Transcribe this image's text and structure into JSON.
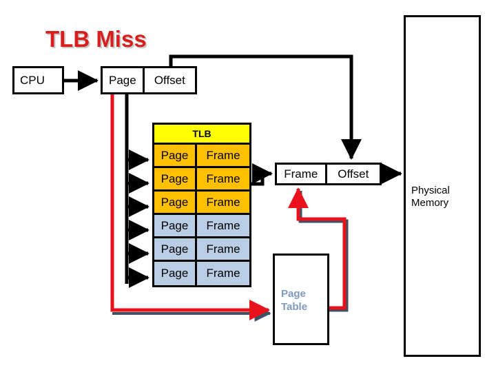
{
  "slide": {
    "title": "TLB Miss",
    "title_color": "#D91E1E",
    "background": "#ffffff"
  },
  "cpu": {
    "label": "CPU"
  },
  "virtual_address": {
    "page_label": "Page",
    "offset_label": "Offset"
  },
  "physical_address": {
    "frame_label": "Frame",
    "offset_label": "Offset"
  },
  "tlb": {
    "header": "TLB",
    "header_color": "#FFFF00",
    "hit_row_color": "#FFC000",
    "miss_row_color": "#B9CDE5",
    "columns": [
      "Page",
      "Frame"
    ],
    "rows": [
      {
        "page": "Page",
        "frame": "Frame",
        "state": "hit"
      },
      {
        "page": "Page",
        "frame": "Frame",
        "state": "hit"
      },
      {
        "page": "Page",
        "frame": "Frame",
        "state": "hit"
      },
      {
        "page": "Page",
        "frame": "Frame",
        "state": "miss"
      },
      {
        "page": "Page",
        "frame": "Frame",
        "state": "miss"
      },
      {
        "page": "Page",
        "frame": "Frame",
        "state": "miss"
      }
    ]
  },
  "page_table": {
    "label_line1": "Page",
    "label_line2": "Table",
    "label_color": "#7E9ABF"
  },
  "physical_memory": {
    "label_line1": "Physical",
    "label_line2": "Memory"
  },
  "connectors": {
    "black_color": "#000000",
    "red_color": "#E8121B",
    "shadow_color": "#3F5164"
  }
}
